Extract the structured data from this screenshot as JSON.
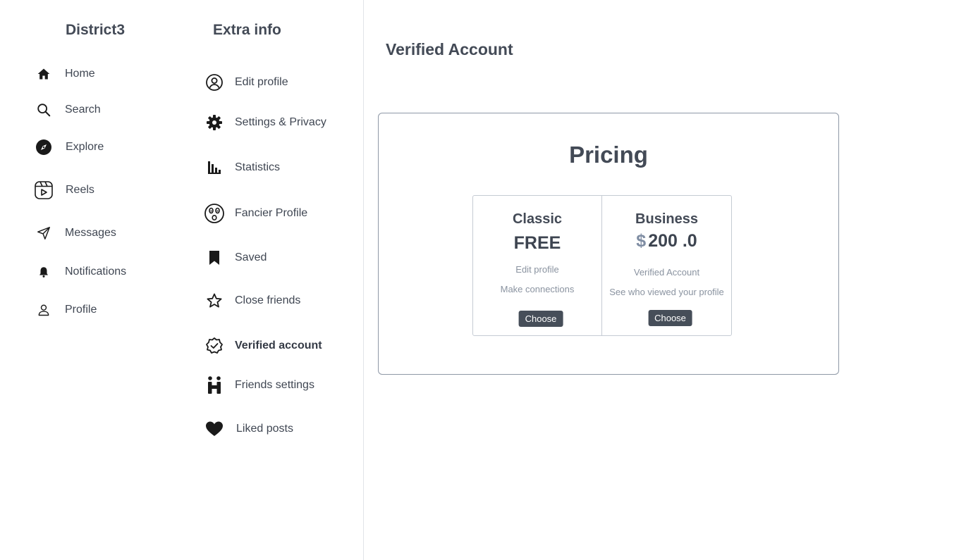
{
  "sidebar": {
    "brand": "District3",
    "items": [
      {
        "label": "Home",
        "icon": "home-icon"
      },
      {
        "label": "Search",
        "icon": "search-icon"
      },
      {
        "label": "Explore",
        "icon": "compass-icon"
      },
      {
        "label": "Reels",
        "icon": "reels-icon"
      },
      {
        "label": "Messages",
        "icon": "send-icon"
      },
      {
        "label": "Notifications",
        "icon": "bell-icon"
      },
      {
        "label": "Profile",
        "icon": "user-icon"
      }
    ]
  },
  "extra": {
    "title": "Extra info",
    "items": [
      {
        "label": "Edit profile",
        "icon": "user-circle-icon"
      },
      {
        "label": "Settings & Privacy",
        "icon": "gear-icon"
      },
      {
        "label": "Statistics",
        "icon": "bar-chart-icon"
      },
      {
        "label": "Fancier Profile",
        "icon": "face-icon"
      },
      {
        "label": "Saved",
        "icon": "bookmark-icon"
      },
      {
        "label": "Close friends",
        "icon": "star-icon"
      },
      {
        "label": "Verified account",
        "icon": "verified-badge-icon",
        "active": true
      },
      {
        "label": "Friends settings",
        "icon": "friends-icon"
      },
      {
        "label": "Liked posts",
        "icon": "heart-icon"
      }
    ]
  },
  "main": {
    "title": "Verified Account",
    "pricing": {
      "title": "Pricing",
      "plans": [
        {
          "name": "Classic",
          "price": "FREE",
          "features": [
            "Edit profile",
            "Make connections"
          ],
          "button": "Choose"
        },
        {
          "name": "Business",
          "currency": "$",
          "price": "200 .0",
          "features": [
            "Verified Account",
            "See who viewed your profile"
          ],
          "button": "Choose"
        }
      ]
    }
  }
}
